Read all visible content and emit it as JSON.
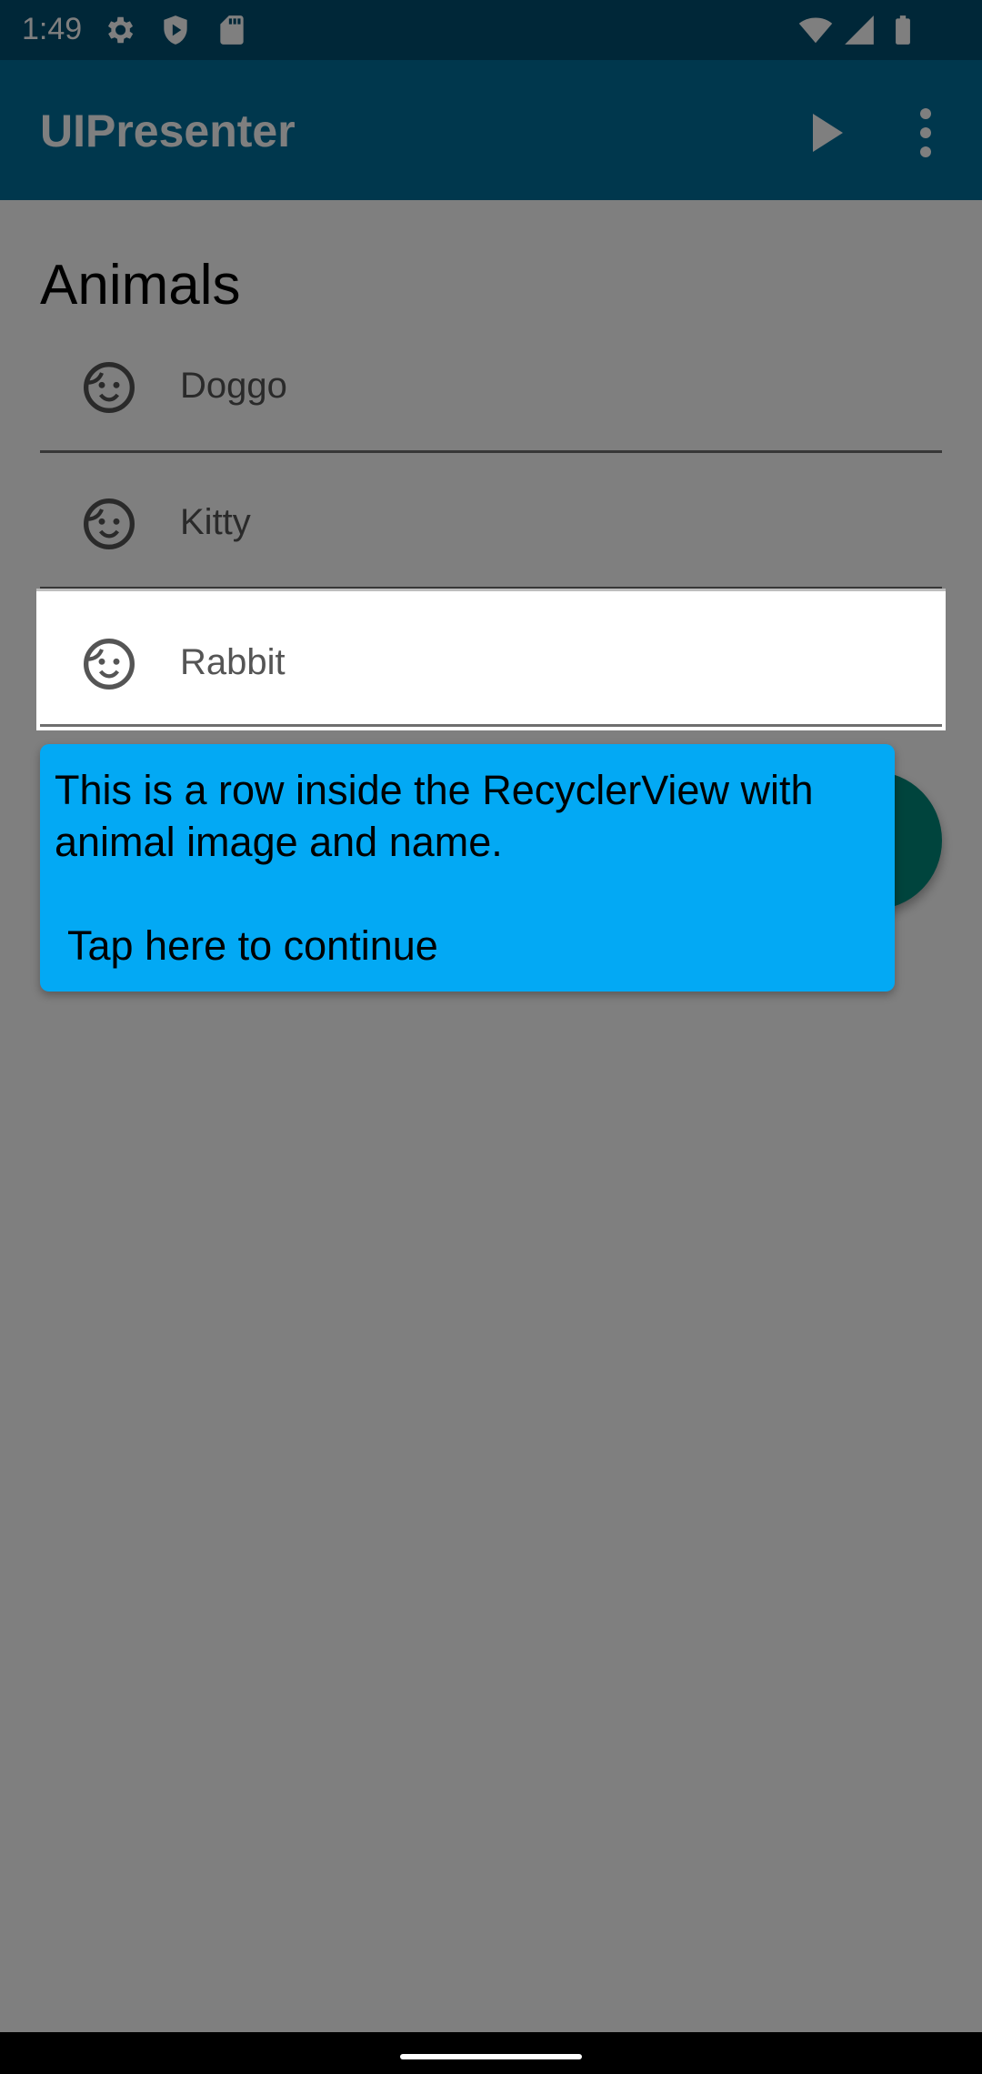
{
  "status_bar": {
    "time": "1:49",
    "icons": [
      "gear-icon",
      "shield-icon",
      "sd-card-icon",
      "wifi-icon",
      "signal-icon",
      "battery-icon"
    ]
  },
  "app_bar": {
    "title": "UIPresenter",
    "actions": [
      "play-icon",
      "more-vert-icon"
    ],
    "color": "#016e9b"
  },
  "content": {
    "section_title": "Animals",
    "rows": [
      {
        "icon": "face-icon",
        "name": "Doggo"
      },
      {
        "icon": "face-icon",
        "name": "Kitty"
      },
      {
        "icon": "face-icon",
        "name": "Rabbit"
      }
    ],
    "fab_color": "#00897b"
  },
  "tooltip": {
    "text": "This is a row inside the RecyclerView with animal image and name.",
    "action": "Tap here to continue",
    "color": "#03a9f4"
  }
}
